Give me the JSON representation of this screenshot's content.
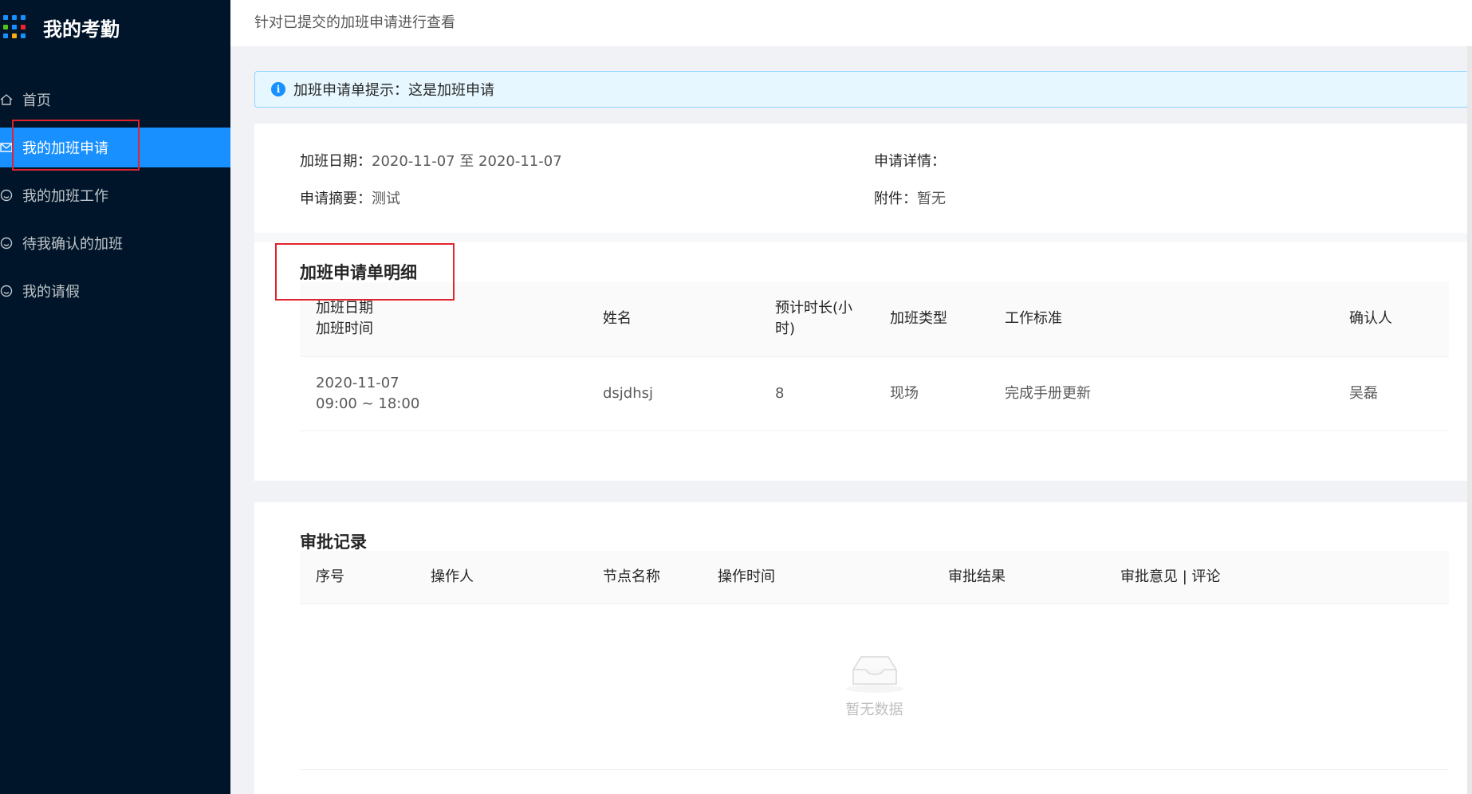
{
  "app": {
    "title": "我的考勤",
    "logo_colors": [
      "#1890ff",
      "#1890ff",
      "#1890ff",
      "#52c41a",
      "#1890ff",
      "#f5222d",
      "#1890ff",
      "#faad14",
      "#1890ff"
    ]
  },
  "sidebar": {
    "items": [
      {
        "label": "首页",
        "icon": "home-icon",
        "active": false
      },
      {
        "label": "我的加班申请",
        "icon": "mail-icon",
        "active": true
      },
      {
        "label": "我的加班工作",
        "icon": "smile-icon",
        "active": false
      },
      {
        "label": "待我确认的加班",
        "icon": "smile-icon",
        "active": false
      },
      {
        "label": "我的请假",
        "icon": "smile-icon",
        "active": false
      }
    ]
  },
  "header": {
    "subtitle": "针对已提交的加班申请进行查看"
  },
  "alert": {
    "icon": "info-icon",
    "glyph": "i",
    "text": "加班申请单提示：这是加班申请"
  },
  "summary": {
    "date_label": "加班日期：",
    "date_value": "2020-11-07 至 2020-11-07",
    "detail_label": "申请详情：",
    "detail_value": "",
    "abstract_label": "申请摘要：",
    "abstract_value": "测试",
    "attachment_label": "附件：",
    "attachment_value": "暂无"
  },
  "detail_table": {
    "title": "加班申请单明细",
    "headers": {
      "date_line1": "加班日期",
      "date_line2": "加班时间",
      "name": "姓名",
      "duration": "预计时长(小时)",
      "type": "加班类型",
      "standard": "工作标准",
      "confirmer": "确认人"
    },
    "rows": [
      {
        "date": "2020-11-07",
        "time": "09:00 ~ 18:00",
        "name": "dsjdhsj",
        "duration": "8",
        "type": "现场",
        "standard": "完成手册更新",
        "confirmer": "吴磊"
      }
    ]
  },
  "approval_table": {
    "title": "审批记录",
    "headers": {
      "index": "序号",
      "operator": "操作人",
      "node": "节点名称",
      "time": "操作时间",
      "result": "审批结果",
      "opinion": "审批意见 | 评论"
    },
    "empty_text": "暂无数据",
    "empty_icon": "inbox-icon"
  },
  "colors": {
    "sidebar_bg": "#001529",
    "accent": "#1890ff",
    "highlight_box": "#e0242f"
  }
}
